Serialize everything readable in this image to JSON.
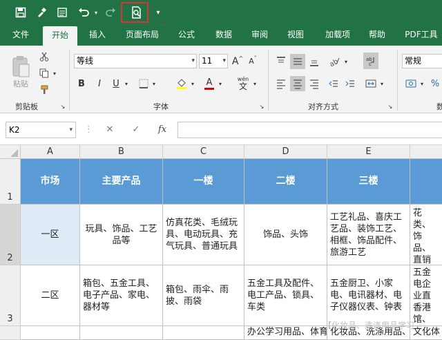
{
  "qat": {
    "save_icon": "save-icon",
    "brush_icon": "format-painter-icon",
    "form_icon": "form-icon",
    "undo_icon": "undo-icon",
    "redo_icon": "redo-icon",
    "preview_icon": "print-preview-icon",
    "customize_icon": "customize-qat-icon"
  },
  "tabs": [
    "文件",
    "开始",
    "插入",
    "页面布局",
    "公式",
    "数据",
    "审阅",
    "视图",
    "加载项",
    "帮助",
    "PDF工具"
  ],
  "active_tab": "开始",
  "ribbon": {
    "clipboard": {
      "paste_label": "粘贴",
      "group_label": "剪贴板"
    },
    "font": {
      "font_name": "等线",
      "font_size": "11",
      "group_label": "字体",
      "bold": "B",
      "italic": "I",
      "underline": "U",
      "grow": "A",
      "shrink": "A",
      "phonetic_top": "wén",
      "phonetic_bottom": "文"
    },
    "alignment": {
      "group_label": "对齐方式"
    },
    "number": {
      "format": "常规",
      "group_label": "数"
    }
  },
  "formula_bar": {
    "name_box": "K2",
    "value": "",
    "fx": "fx"
  },
  "columns": [
    "A",
    "B",
    "C",
    "D",
    "E"
  ],
  "rows": [
    "1",
    "2",
    "3"
  ],
  "table": {
    "header": [
      "市场",
      "主要产品",
      "一楼",
      "二楼",
      "三楼",
      ""
    ],
    "r2": [
      "一区",
      "玩具、饰品、工艺品等",
      "仿真花类、毛绒玩具、电动玩具、充气玩具、普通玩具",
      "饰品、头饰",
      "工艺礼品、喜庆工艺品、装饰工艺、相框、饰品配件、旅游工艺",
      "花类、饰品、直销中"
    ],
    "r3": [
      "二区",
      "箱包、五金工具、电子产品、家电、器材等",
      "箱包、雨伞、雨披、雨袋",
      "五金工具及配件、电工产品、锁具、车类",
      "五金厨卫、小家电、电讯器材、电子仪器仪表、钟表",
      "五金电企业直香港馆、四川"
    ],
    "r4": [
      "",
      "",
      "",
      "办公学习用品、体育用品、办公",
      "化妆品、洗涤用品、时用品、饰件",
      "文化体"
    ]
  },
  "watermark": "【化妆品、洗涤用品学习"
}
